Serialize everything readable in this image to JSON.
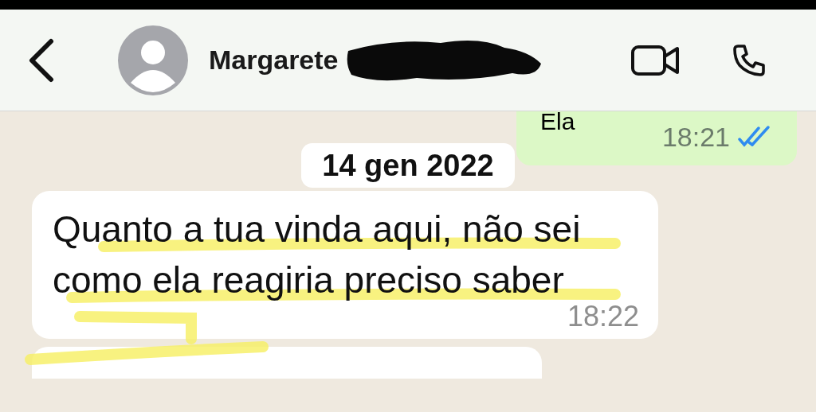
{
  "header": {
    "contact_name": "Margarete",
    "name_redacted": true
  },
  "messages": [
    {
      "kind": "outgoing",
      "text": "Ela",
      "time": "18:21",
      "read": true
    },
    {
      "kind": "date",
      "text": "14 gen 2022"
    },
    {
      "kind": "incoming",
      "text": "Quanto a tua vinda aqui, não sei como ela reagiria preciso saber",
      "time": "18:22",
      "highlighted": true
    }
  ]
}
